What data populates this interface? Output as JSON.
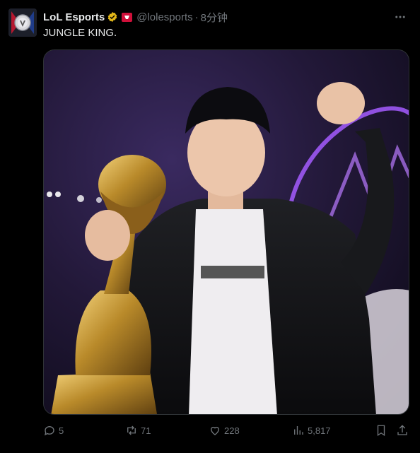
{
  "tweet": {
    "author": {
      "name": "LoL Esports",
      "handle": "@lolesports",
      "verified_icon": "verified-gold-badge-icon",
      "affiliate_icon": "affiliate-badge-icon",
      "avatar_icon": "lol-esports-logo"
    },
    "time": "8分钟",
    "separator": "·",
    "text": "JUNGLE KING.",
    "media_alt_icon": "player-holding-trophy-photo",
    "actions": {
      "reply": {
        "icon": "reply-icon",
        "count": "5"
      },
      "retweet": {
        "icon": "retweet-icon",
        "count": "71"
      },
      "like": {
        "icon": "heart-icon",
        "count": "228"
      },
      "views": {
        "icon": "views-chart-icon",
        "count": "5,817"
      },
      "bookmark": {
        "icon": "bookmark-icon"
      },
      "share": {
        "icon": "share-icon"
      }
    }
  },
  "colors": {
    "background": "#000000",
    "text": "#e7e9ea",
    "muted": "#71767b",
    "verified_gold": "#e2b719",
    "affiliate_red": "#d0103a"
  }
}
